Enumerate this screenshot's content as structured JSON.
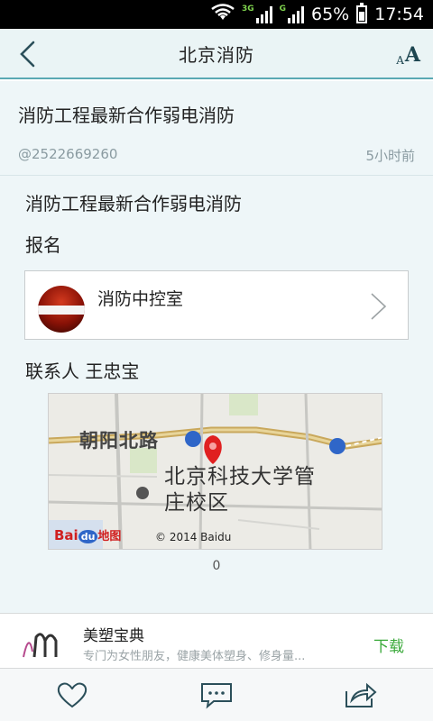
{
  "status_bar": {
    "wifi_icon": "wifi-icon",
    "net1_label": "3G",
    "net2_label": "G",
    "battery_percent": "65%",
    "battery_level": 0.65,
    "time": "17:54"
  },
  "nav": {
    "back_icon": "back-arrow-icon",
    "title": "北京消防",
    "font_size_small": "A",
    "font_size_big": "A"
  },
  "article": {
    "title": "消防工程最新合作弱电消防",
    "author": "@2522669260",
    "time": "5小时前",
    "line1": "消防工程最新合作弱电消防",
    "line2": "报名",
    "card_label": "消防中控室",
    "contact": "联系人 王忠宝"
  },
  "map": {
    "road_label": "朝阳北路",
    "place_label": "北京科技大学管庄校区",
    "logo_bai": "Bai",
    "logo_du": "du",
    "logo_ditu": "地图",
    "copyright": "© 2014 Baidu"
  },
  "like_count": "0",
  "ad": {
    "title": "美塑宝典",
    "description": "专门为女性朋友，健康美体塑身、修身量...",
    "action": "下载"
  },
  "toolbar": {
    "like_icon": "heart-icon",
    "comment_icon": "comment-icon",
    "share_icon": "share-icon"
  },
  "colors": {
    "accent": "#5aa9b3",
    "background": "#eef6f8",
    "download": "#3aa93a"
  }
}
